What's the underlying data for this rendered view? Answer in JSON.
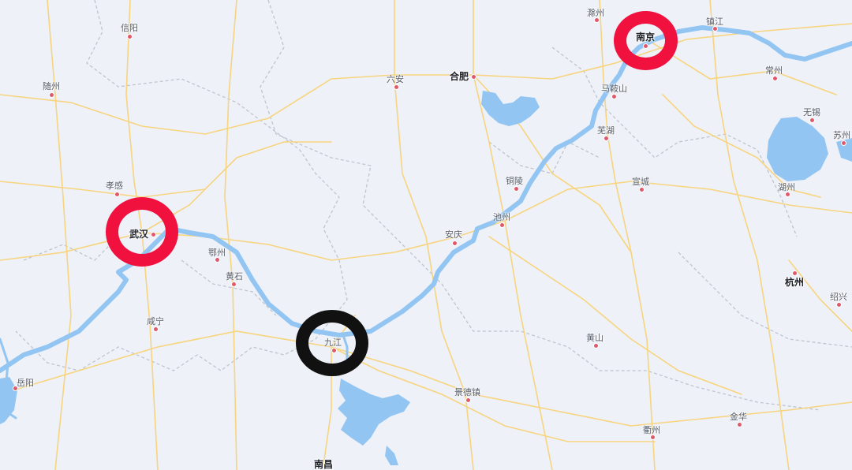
{
  "cities": {
    "xinyang": "信阳",
    "suizhou": "随州",
    "xiaogan": "孝感",
    "wuhan": "武汉",
    "ezhou": "鄂州",
    "huangshi": "黄石",
    "xianning": "咸宁",
    "yueyang": "岳阳",
    "liuan": "六安",
    "hefei": "合肥",
    "anqing": "安庆",
    "jiujiang": "九江",
    "nanchang": "南昌",
    "jingdezhen": "景德镇",
    "chizhou": "池州",
    "tongling": "铜陵",
    "huangshan": "黄山",
    "wuhu": "芜湖",
    "maanshan": "马鞍山",
    "chuzhou": "滁州",
    "nanjing": "南京",
    "zhenjiang": "镇江",
    "xuancheng": "宣城",
    "changzhou": "常州",
    "wuxi": "无锡",
    "suzhou": "苏州",
    "huzhou": "湖州",
    "hangzhou": "杭州",
    "shaoxing": "绍兴",
    "jinhua": "金华",
    "quzhou": "衢州"
  },
  "markers": [
    {
      "city": "南京",
      "color": "#f0113f"
    },
    {
      "city": "武汉",
      "color": "#f0113f"
    },
    {
      "city": "九江",
      "color": "#111111"
    }
  ],
  "colors": {
    "land": "#eef1f8",
    "water": "#93c5f2",
    "road": "#f7d47e",
    "boundary": "#bfc4cd",
    "city_dot": "#e0596b",
    "marker_red": "#f0113f",
    "marker_black": "#111111"
  }
}
